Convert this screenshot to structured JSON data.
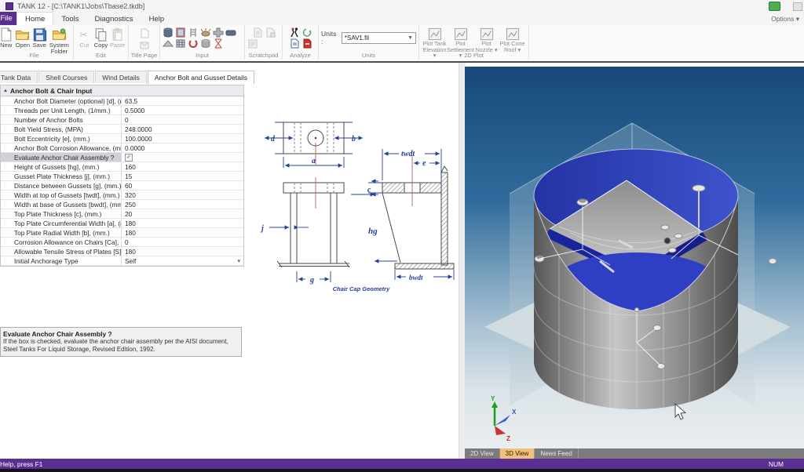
{
  "window": {
    "title": "TANK 12 - [C:\\TANK1\\Jobs\\Tbase2.tkdb]"
  },
  "menubar": {
    "file_button": "File",
    "tabs": [
      "Home",
      "Tools",
      "Diagnostics",
      "Help"
    ],
    "options": "Options ▾"
  },
  "ribbon": {
    "file_group": {
      "label": "File",
      "new": "New",
      "open": "Open",
      "save": "Save",
      "system_folder": "System Folder"
    },
    "edit_group": {
      "label": "Edit",
      "cut": "Cut",
      "copy": "Copy",
      "paste": "Paste"
    },
    "title_page_group": {
      "label": "Title Page"
    },
    "input_group": {
      "label": "Input"
    },
    "scratchpad_group": {
      "label": "Scratchpad"
    },
    "analyze_group": {
      "label": "Analyze"
    },
    "units_group": {
      "label": "Units",
      "field_label": "Units :",
      "value": "*SAV1.fil"
    },
    "plot_group": {
      "label": "2D Plot",
      "buttons": [
        "Plot Tank Elevation ▾",
        "Plot Settlement ▾",
        "Plot Nozzle ▾",
        "Plot Cone Roof ▾"
      ]
    }
  },
  "doc_tabs": {
    "items": [
      "Tank Data",
      "Shell Courses",
      "Wind Details",
      "Anchor Bolt and Gusset Details"
    ],
    "active_index": 3
  },
  "property_grid": {
    "section": "Anchor Bolt & Chair Input",
    "rows": [
      {
        "label": "Anchor Bolt Diameter (optional) [d], (mm.)",
        "value": "63.5"
      },
      {
        "label": "Threads per Unit Length, (1/mm.)",
        "value": "0.5000"
      },
      {
        "label": "Number of Anchor Bolts",
        "value": "0"
      },
      {
        "label": "Bolt Yield Stress, (MPA)",
        "value": "248.0000"
      },
      {
        "label": "Bolt Eccentricity [e], (mm.)",
        "value": "100.0000"
      },
      {
        "label": "Anchor Bolt Corrosion Allowance, (mm.)",
        "value": "0.0000"
      },
      {
        "label": "Evaluate Anchor Chair Assembly ?",
        "value": "checked",
        "type": "checkbox",
        "selected": true
      },
      {
        "label": "Height of Gussets [hg], (mm.)",
        "value": "160"
      },
      {
        "label": "Gusset Plate Thickness [j], (mm.)",
        "value": "15"
      },
      {
        "label": "Distance between Gussets [g], (mm.)",
        "value": "60"
      },
      {
        "label": "Width at top of Gussets [twdt], (mm.)",
        "value": "320"
      },
      {
        "label": "Width at base of Gussets [bwdt], (mm.)",
        "value": "250"
      },
      {
        "label": "Top Plate Thickness [c], (mm.)",
        "value": "20"
      },
      {
        "label": "Top Plate Circumferential Width [a], (mm.)",
        "value": "180"
      },
      {
        "label": "Top Plate Radial Width [b], (mm.)",
        "value": "180"
      },
      {
        "label": "Corrosion Allowance on Chairs [Ca], (mm.)",
        "value": "0"
      },
      {
        "label": "Allowable Tensile Stress of Plates [S], (MPA)",
        "value": "180"
      },
      {
        "label": "Initial Anchorage Type",
        "value": "Self",
        "type": "dropdown"
      }
    ]
  },
  "help_panel": {
    "title": "Evaluate Anchor Chair Assembly ?",
    "body": "If the box is checked, evaluate the anchor chair assembly per the AISI document, Steel Tanks For Liquid Storage, Revised Edition, 1992."
  },
  "diagram": {
    "caption": "Chair Cap Geometry",
    "labels": {
      "d": "d",
      "b": "b",
      "a": "a",
      "j": "j",
      "g": "g",
      "c": "c",
      "hg": "hg",
      "twdt": "twdt",
      "e": "e",
      "bwdt": "bwdt"
    }
  },
  "viewport": {
    "tabs": [
      {
        "label": "2D View",
        "active": false
      },
      {
        "label": "3D View",
        "active": true
      },
      {
        "label": "News Feed",
        "active": false
      }
    ],
    "axis": {
      "x": "X",
      "y": "Y",
      "z": "Z"
    }
  },
  "status_bar": {
    "left": "Help, press F1",
    "right": "NUM"
  },
  "colors": {
    "accent_purple": "#5B2E91",
    "tab_active_orange": "#F2BF7D",
    "roof_blue": "#2B3FC0",
    "liquid_blue": "#2F3FC4"
  }
}
